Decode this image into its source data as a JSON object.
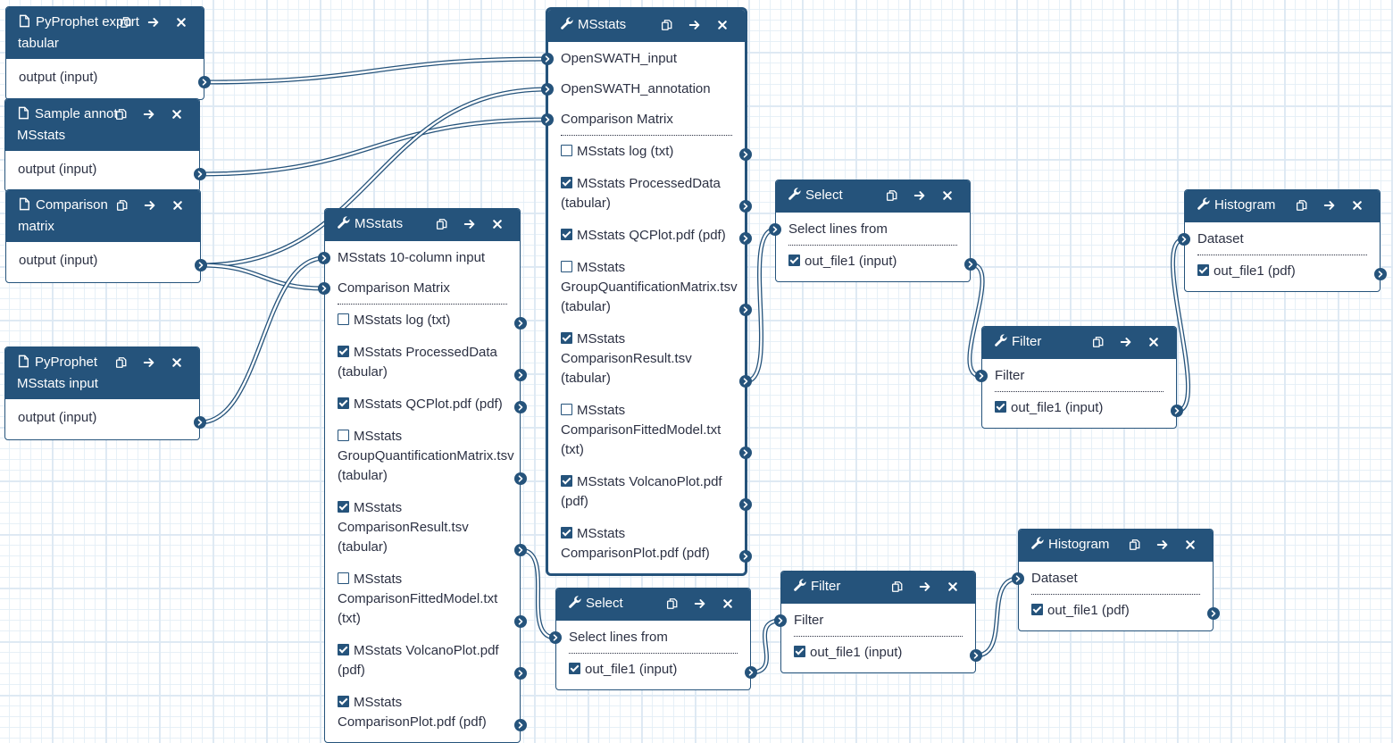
{
  "colors": {
    "accent": "#25537b",
    "text": "#2c3143",
    "grid": "#dce8f3"
  },
  "header_buttons": {
    "copy": "copy-icon",
    "forward": "arrow-right-icon",
    "close": "close-icon"
  },
  "nodes": {
    "pyprophet_export": {
      "type_icon": "file-icon",
      "title": "PyProphet export tabular",
      "outputs": [
        {
          "label": "output (input)"
        }
      ]
    },
    "sample_annot": {
      "type_icon": "file-icon",
      "title": "Sample annot MSstats",
      "outputs": [
        {
          "label": "output (input)"
        }
      ]
    },
    "comparison_matrix": {
      "type_icon": "file-icon",
      "title": "Comparison matrix",
      "outputs": [
        {
          "label": "output (input)"
        }
      ]
    },
    "pyprophet_msstats": {
      "type_icon": "file-icon",
      "title": "PyProphet MSstats input",
      "outputs": [
        {
          "label": "output (input)"
        }
      ]
    },
    "msstats_main": {
      "type_icon": "wrench-icon",
      "title": "MSstats",
      "selected": true,
      "inputs": [
        {
          "label": "OpenSWATH_input"
        },
        {
          "label": "OpenSWATH_annotation"
        },
        {
          "label": "Comparison Matrix"
        }
      ],
      "outputs": [
        {
          "label": "MSstats log (txt)",
          "checked": false
        },
        {
          "label": "MSstats ProcessedData (tabular)",
          "checked": true
        },
        {
          "label": "MSstats QCPlot.pdf (pdf)",
          "checked": true
        },
        {
          "label": "MSstats GroupQuantificationMatrix.tsv (tabular)",
          "checked": false
        },
        {
          "label": "MSstats ComparisonResult.tsv (tabular)",
          "checked": true
        },
        {
          "label": "MSstats ComparisonFittedModel.txt (txt)",
          "checked": false
        },
        {
          "label": "MSstats VolcanoPlot.pdf (pdf)",
          "checked": true
        },
        {
          "label": "MSstats ComparisonPlot.pdf (pdf)",
          "checked": true
        }
      ]
    },
    "msstats_10col": {
      "type_icon": "wrench-icon",
      "title": "MSstats",
      "inputs": [
        {
          "label": "MSstats 10-column input"
        },
        {
          "label": "Comparison Matrix"
        }
      ],
      "outputs": [
        {
          "label": "MSstats log (txt)",
          "checked": false
        },
        {
          "label": "MSstats ProcessedData (tabular)",
          "checked": true
        },
        {
          "label": "MSstats QCPlot.pdf (pdf)",
          "checked": true
        },
        {
          "label": "MSstats GroupQuantificationMatrix.tsv (tabular)",
          "checked": false
        },
        {
          "label": "MSstats ComparisonResult.tsv (tabular)",
          "checked": true
        },
        {
          "label": "MSstats ComparisonFittedModel.txt (txt)",
          "checked": false
        },
        {
          "label": "MSstats VolcanoPlot.pdf (pdf)",
          "checked": true
        },
        {
          "label": "MSstats ComparisonPlot.pdf (pdf)",
          "checked": true
        }
      ]
    },
    "select_top": {
      "type_icon": "wrench-icon",
      "title": "Select",
      "inputs": [
        {
          "label": "Select lines from"
        }
      ],
      "outputs": [
        {
          "label": "out_file1 (input)",
          "checked": true
        }
      ]
    },
    "filter_top": {
      "type_icon": "wrench-icon",
      "title": "Filter",
      "inputs": [
        {
          "label": "Filter"
        }
      ],
      "outputs": [
        {
          "label": "out_file1 (input)",
          "checked": true
        }
      ]
    },
    "histogram_top": {
      "type_icon": "wrench-icon",
      "title": "Histogram",
      "inputs": [
        {
          "label": "Dataset"
        }
      ],
      "outputs": [
        {
          "label": "out_file1 (pdf)",
          "checked": true
        }
      ]
    },
    "select_bottom": {
      "type_icon": "wrench-icon",
      "title": "Select",
      "inputs": [
        {
          "label": "Select lines from"
        }
      ],
      "outputs": [
        {
          "label": "out_file1 (input)",
          "checked": true
        }
      ]
    },
    "filter_bottom": {
      "type_icon": "wrench-icon",
      "title": "Filter",
      "inputs": [
        {
          "label": "Filter"
        }
      ],
      "outputs": [
        {
          "label": "out_file1 (input)",
          "checked": true
        }
      ]
    },
    "histogram_bottom": {
      "type_icon": "wrench-icon",
      "title": "Histogram",
      "inputs": [
        {
          "label": "Dataset"
        }
      ],
      "outputs": [
        {
          "label": "out_file1 (pdf)",
          "checked": true
        }
      ]
    }
  },
  "connections": [
    {
      "from": "pyprophet_export.out.0",
      "to": "msstats_main.in.0"
    },
    {
      "from": "sample_annot.out.0",
      "to": "msstats_main.in.2"
    },
    {
      "from": "comparison_matrix.out.0",
      "to": "msstats_main.in.1"
    },
    {
      "from": "comparison_matrix.out.0",
      "to": "msstats_10col.in.1"
    },
    {
      "from": "pyprophet_msstats.out.0",
      "to": "msstats_10col.in.0"
    },
    {
      "from": "msstats_main.out.4",
      "to": "select_top.in.0"
    },
    {
      "from": "select_top.out.0",
      "to": "filter_top.in.0"
    },
    {
      "from": "filter_top.out.0",
      "to": "histogram_top.in.0"
    },
    {
      "from": "msstats_10col.out.4",
      "to": "select_bottom.in.0"
    },
    {
      "from": "select_bottom.out.0",
      "to": "filter_bottom.in.0"
    },
    {
      "from": "filter_bottom.out.0",
      "to": "histogram_bottom.in.0"
    }
  ]
}
